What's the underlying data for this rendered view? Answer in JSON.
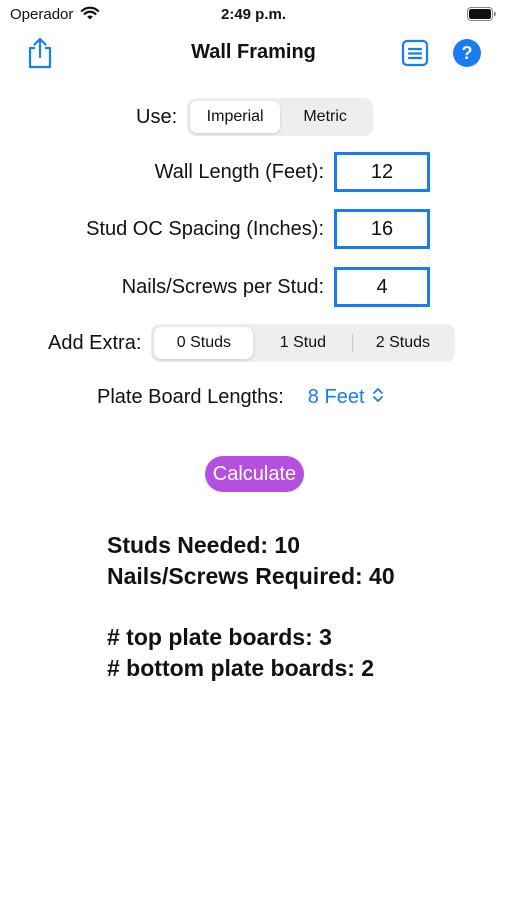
{
  "status_bar": {
    "carrier": "Operador",
    "time": "2:49 p.m."
  },
  "nav": {
    "title": "Wall Framing",
    "icons": [
      "share-icon",
      "list-icon",
      "help-icon"
    ],
    "help_glyph": "?"
  },
  "units": {
    "label": "Use:",
    "options": [
      "Imperial",
      "Metric"
    ],
    "selected": "Imperial"
  },
  "fields": {
    "wall_length": {
      "label": "Wall Length (Feet):",
      "value": "12"
    },
    "stud_spacing": {
      "label": "Stud OC Spacing (Inches):",
      "value": "16"
    },
    "nails_per_stud": {
      "label": "Nails/Screws per Stud:",
      "value": "4"
    }
  },
  "extra": {
    "label": "Add Extra:",
    "options": [
      "0 Studs",
      "1 Stud",
      "2 Studs"
    ],
    "selected": "0 Studs"
  },
  "plate": {
    "label": "Plate Board Lengths:",
    "value": "8 Feet"
  },
  "calculate_label": "Calculate",
  "results": {
    "studs_needed": "Studs Needed: 10",
    "nails_required": "Nails/Screws Required: 40",
    "top_plate": "# top plate boards: 3",
    "bottom_plate": "# bottom plate boards: 2"
  },
  "colors": {
    "accent": "#1a7cf5",
    "calculate": "#b44fe0",
    "segment_bg": "#eeeef0"
  }
}
